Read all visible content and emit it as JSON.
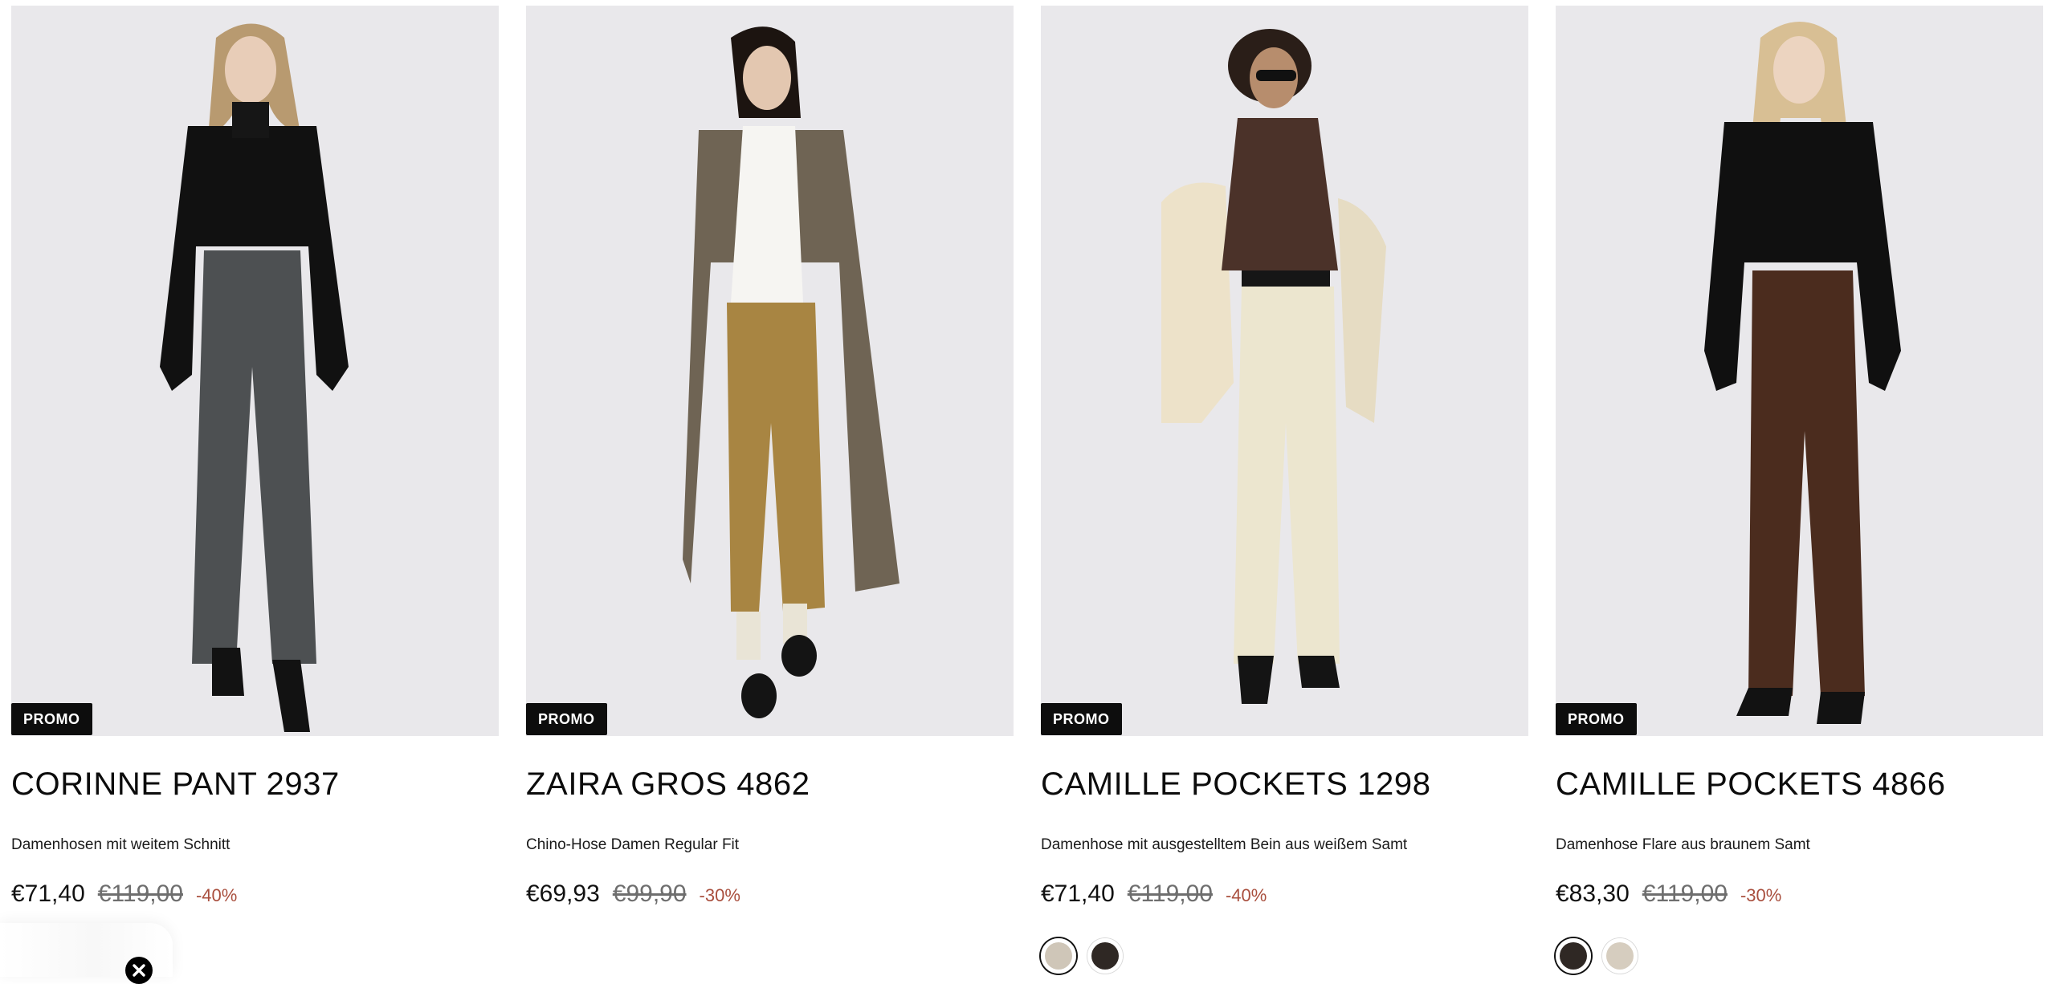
{
  "colors": {
    "badge_bg": "#0d0d0d",
    "discount": "#a94f3e",
    "old_price": "#6e6e6e",
    "image_bg": "#e8e7ea"
  },
  "products": [
    {
      "badge": "PROMO",
      "title": "CORINNE PANT 2937",
      "subtitle": "Damenhosen mit weitem Schnitt",
      "price": "€71,40",
      "old_price": "€119,00",
      "discount": "-40%",
      "swatches": []
    },
    {
      "badge": "PROMO",
      "title": "ZAIRA GROS 4862",
      "subtitle": "Chino-Hose Damen Regular Fit",
      "price": "€69,93",
      "old_price": "€99,90",
      "discount": "-30%",
      "swatches": []
    },
    {
      "badge": "PROMO",
      "title": "CAMILLE POCKETS 1298",
      "subtitle": "Damenhose mit ausgestelltem Bein aus weißem Samt",
      "price": "€71,40",
      "old_price": "€119,00",
      "discount": "-40%",
      "swatches": [
        {
          "color": "#cfc6b8",
          "selected": true
        },
        {
          "color": "#2f2824",
          "selected": false
        }
      ]
    },
    {
      "badge": "PROMO",
      "title": "CAMILLE POCKETS 4866",
      "subtitle": "Damenhose Flare aus braunem Samt",
      "price": "€83,30",
      "old_price": "€119,00",
      "discount": "-30%",
      "swatches": [
        {
          "color": "#2f2824",
          "selected": true
        },
        {
          "color": "#d6cdbf",
          "selected": false
        }
      ]
    }
  ],
  "overlay": {
    "close_icon": "close-circle-icon"
  }
}
